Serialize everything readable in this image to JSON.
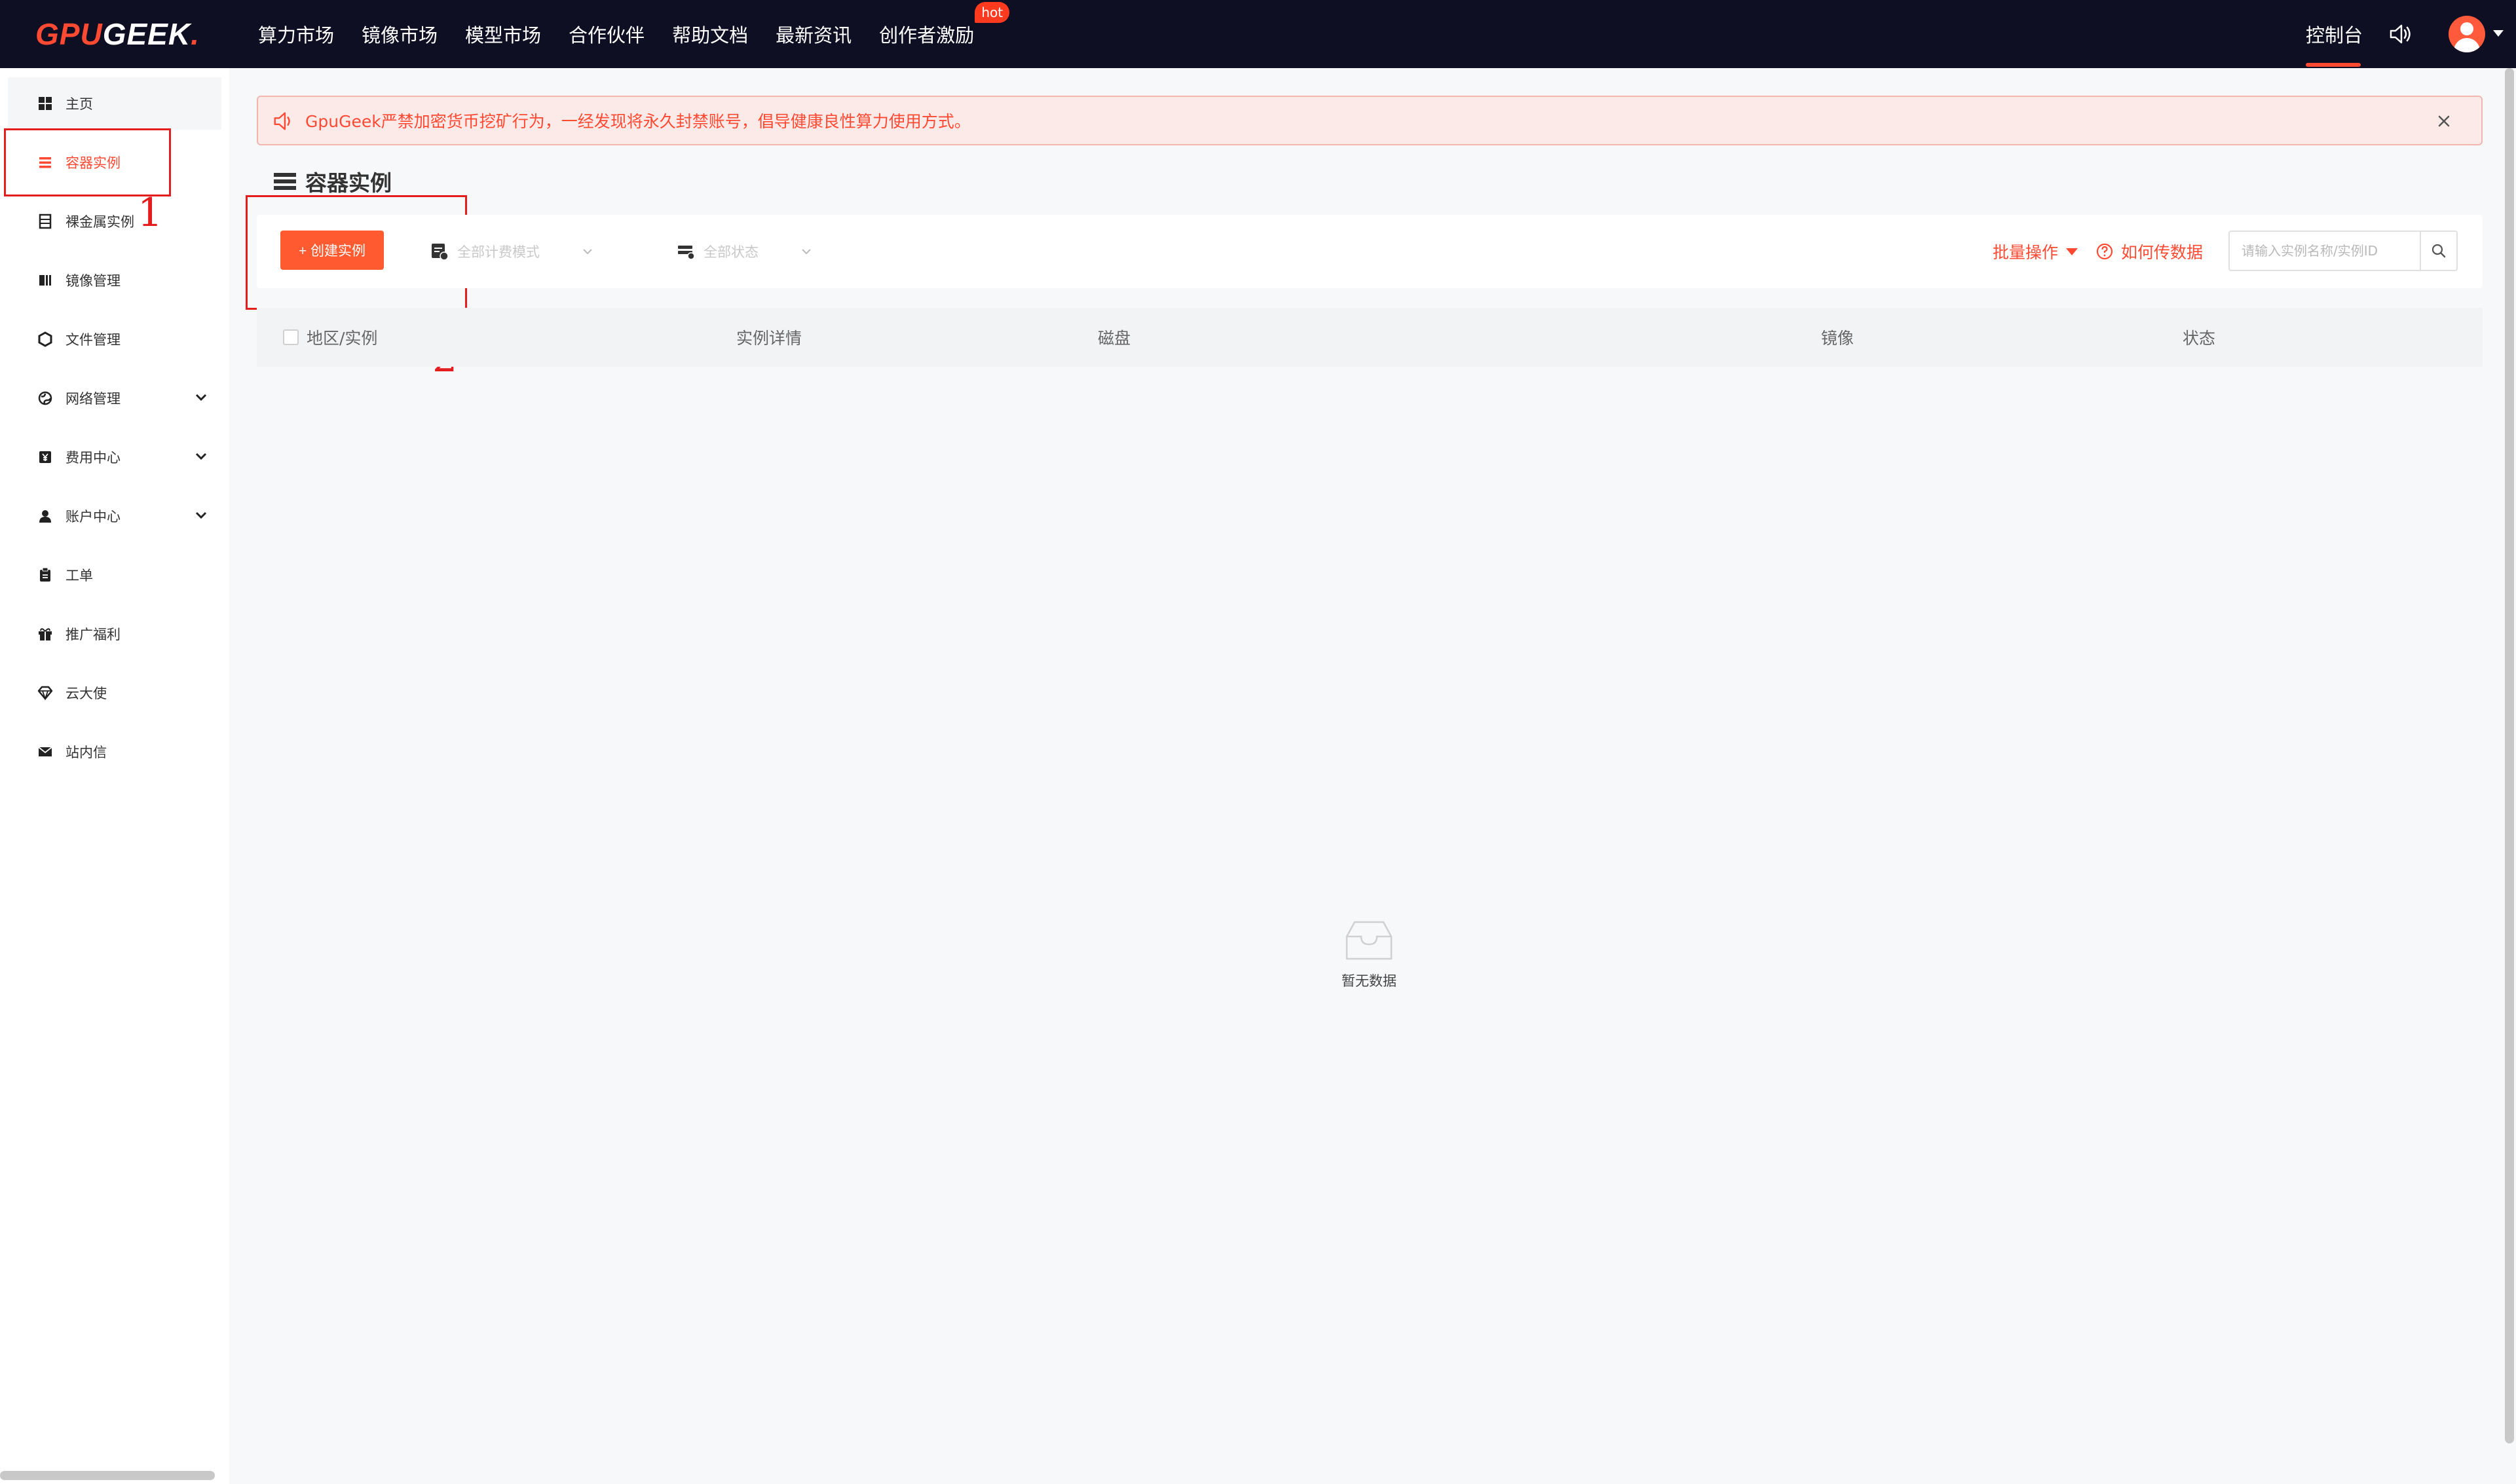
{
  "brand": {
    "part1": "GPU",
    "part2": "GEEK",
    "dot": "."
  },
  "nav": {
    "items": [
      "算力市场",
      "镜像市场",
      "模型市场",
      "合作伙伴",
      "帮助文档",
      "最新资讯",
      "创作者激励"
    ],
    "hot_badge": "hot",
    "console": "控制台"
  },
  "sidebar": {
    "items": [
      {
        "label": "主页",
        "icon": "grid-icon"
      },
      {
        "label": "容器实例",
        "icon": "list-icon"
      },
      {
        "label": "裸金属实例",
        "icon": "server-icon"
      },
      {
        "label": "镜像管理",
        "icon": "image-icon"
      },
      {
        "label": "文件管理",
        "icon": "hexagon-icon"
      },
      {
        "label": "网络管理",
        "icon": "globe-icon"
      },
      {
        "label": "费用中心",
        "icon": "yen-icon"
      },
      {
        "label": "账户中心",
        "icon": "user-icon"
      },
      {
        "label": "工单",
        "icon": "clipboard-icon"
      },
      {
        "label": "推广福利",
        "icon": "gift-icon"
      },
      {
        "label": "云大使",
        "icon": "diamond-icon"
      },
      {
        "label": "站内信",
        "icon": "mail-icon"
      }
    ]
  },
  "annotations": {
    "one": "1",
    "two": "2"
  },
  "notice": {
    "text": "GpuGeek严禁加密货币挖矿行为，一经发现将永久封禁账号，倡导健康良性算力使用方式。"
  },
  "page": {
    "title": "容器实例"
  },
  "toolbar": {
    "create_label": "+ 创建实例",
    "billing_filter": "全部计费模式",
    "status_filter": "全部状态",
    "batch_label": "批量操作",
    "howto_label": "如何传数据",
    "search_placeholder": "请输入实例名称/实例ID"
  },
  "table": {
    "columns": [
      "地区/实例",
      "实例详情",
      "磁盘",
      "镜像",
      "状态"
    ]
  },
  "empty": {
    "text": "暂无数据"
  },
  "colors": {
    "accent": "#ff4a33",
    "nav_bg": "#0e0f22",
    "annotation": "#e41e1e"
  }
}
